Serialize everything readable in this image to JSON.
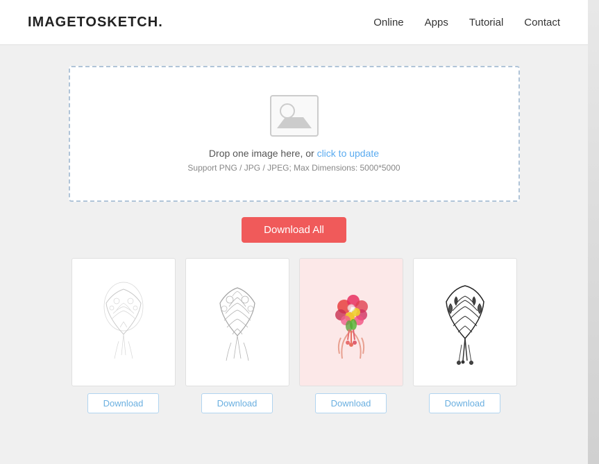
{
  "header": {
    "logo": "IMAGETOSKETCH.",
    "nav": {
      "online": "Online",
      "apps": "Apps",
      "tutorial": "Tutorial",
      "contact": "Contact"
    }
  },
  "dropzone": {
    "main_text": "Drop one image here, or ",
    "click_text": "click to update",
    "support_text": "Support PNG / JPG / JPEG; Max Dimensions: 5000*5000"
  },
  "download_all_button": "Download All",
  "gallery": {
    "items": [
      {
        "id": 1,
        "highlighted": false,
        "download_label": "Download"
      },
      {
        "id": 2,
        "highlighted": false,
        "download_label": "Download"
      },
      {
        "id": 3,
        "highlighted": true,
        "download_label": "Download"
      },
      {
        "id": 4,
        "highlighted": false,
        "download_label": "Download"
      }
    ]
  }
}
